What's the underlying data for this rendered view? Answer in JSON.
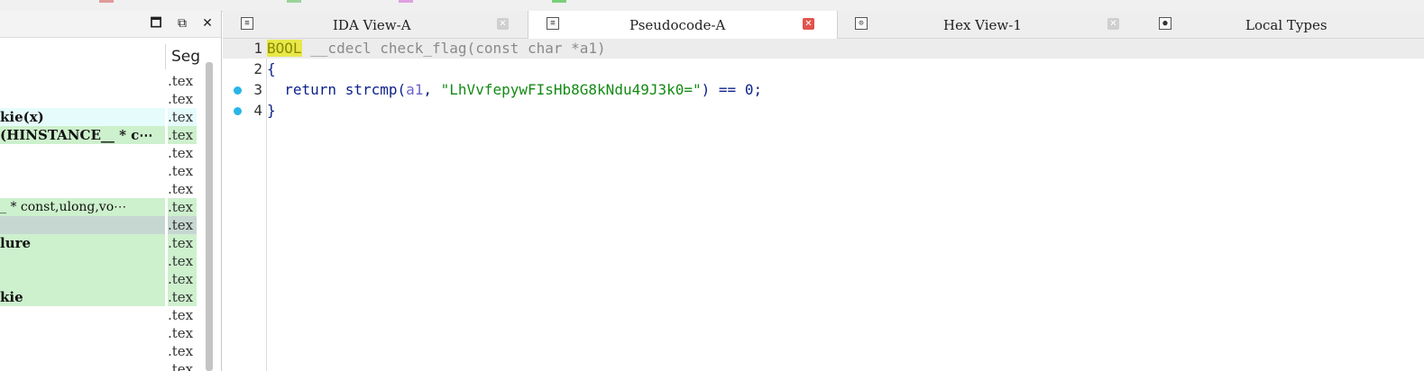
{
  "left_pane": {
    "buttons": {
      "maximize": "🗖",
      "restore": "⧉",
      "close": "✕"
    },
    "column_header": "Seg",
    "rows": [
      {
        "name": "",
        "seg": ".tex",
        "style": ""
      },
      {
        "name": "",
        "seg": ".tex",
        "style": ""
      },
      {
        "name": "kie(x)",
        "seg": ".tex",
        "style": "cyan"
      },
      {
        "name": "(HINSTANCE__ * c⋯",
        "seg": ".tex",
        "style": "green"
      },
      {
        "name": "",
        "seg": ".tex",
        "style": ""
      },
      {
        "name": "",
        "seg": ".tex",
        "style": ""
      },
      {
        "name": "",
        "seg": ".tex",
        "style": ""
      },
      {
        "name": "_ * const,ulong,vo⋯",
        "seg": ".tex",
        "style": "green small"
      },
      {
        "name": "",
        "seg": ".tex",
        "style": "gray"
      },
      {
        "name": "lure",
        "seg": ".tex",
        "style": "green"
      },
      {
        "name": "",
        "seg": ".tex",
        "style": "green"
      },
      {
        "name": "",
        "seg": ".tex",
        "style": "green"
      },
      {
        "name": "kie",
        "seg": ".tex",
        "style": "green"
      },
      {
        "name": "",
        "seg": ".tex",
        "style": ""
      },
      {
        "name": "",
        "seg": ".tex",
        "style": ""
      },
      {
        "name": "",
        "seg": ".tex",
        "style": ""
      },
      {
        "name": "",
        "seg": ".tex",
        "style": ""
      }
    ]
  },
  "tabs": [
    {
      "label": "IDA View-A",
      "icon": "text-view-icon",
      "close": "✕",
      "active": false
    },
    {
      "label": "Pseudocode-A",
      "icon": "text-view-icon",
      "close": "✕",
      "active": true
    },
    {
      "label": "Hex View-1",
      "icon": "hex-view-icon",
      "close": "✕",
      "active": false
    },
    {
      "label": "Local Types",
      "icon": "local-types-icon",
      "close": "",
      "active": false
    }
  ],
  "editor": {
    "lines": [
      {
        "num": "1",
        "breakpoint": false,
        "tokens": [
          "BOOL",
          " __cdecl check_flag(const char *a1)"
        ]
      },
      {
        "num": "2",
        "breakpoint": false,
        "tokens": [
          "{"
        ]
      },
      {
        "num": "3",
        "breakpoint": true,
        "tokens": [
          "  return strcmp(",
          "a1",
          ", ",
          "\"LhVvfepywFIsHb8G8kNdu49J3k0=\"",
          ") == ",
          "0",
          ";"
        ]
      },
      {
        "num": "4",
        "breakpoint": true,
        "tokens": [
          "}"
        ]
      }
    ]
  },
  "colors": {
    "breakpoint": "#2ab5e8",
    "string": "#138a13",
    "keyword_highlight": "#e8e84a",
    "active_close": "#e0544e"
  }
}
